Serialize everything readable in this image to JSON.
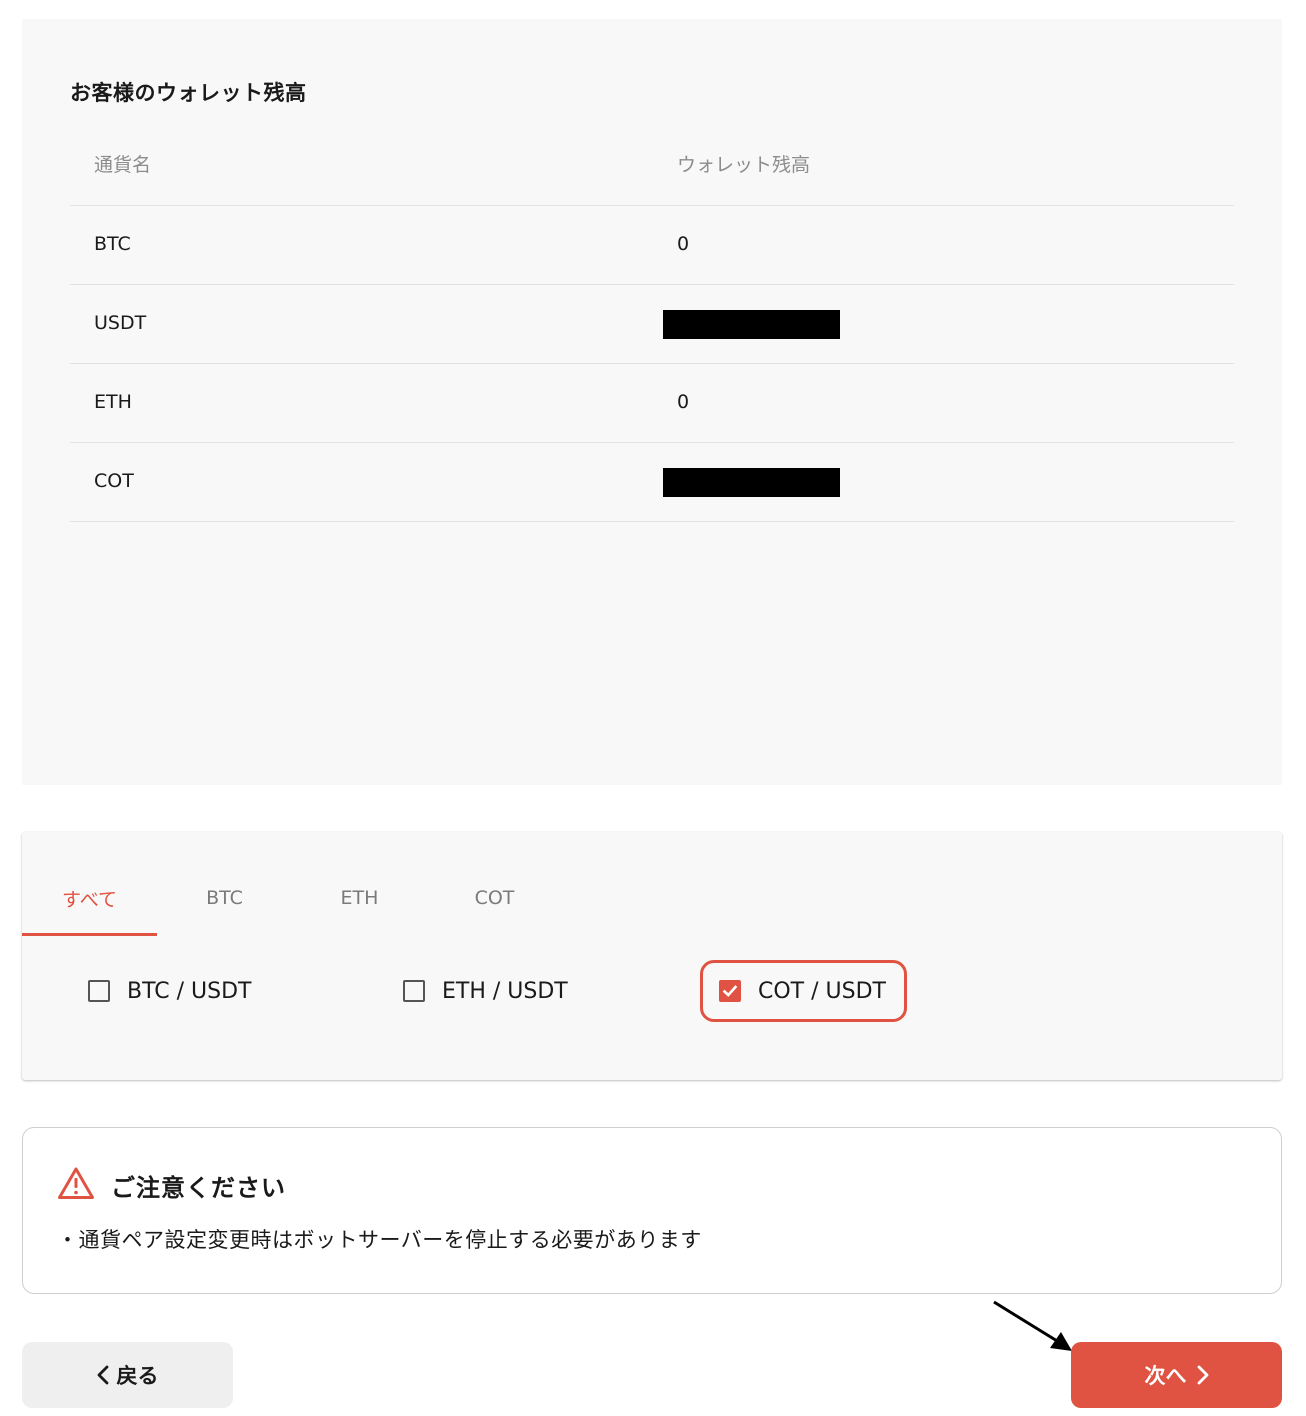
{
  "wallet": {
    "title": "お客様のウォレット残高",
    "headers": {
      "currency": "通貨名",
      "balance": "ウォレット残高"
    },
    "rows": [
      {
        "currency": "BTC",
        "balance": "0"
      },
      {
        "currency": "USDT",
        "balance": ""
      },
      {
        "currency": "ETH",
        "balance": "0"
      },
      {
        "currency": "COT",
        "balance": ""
      }
    ]
  },
  "pair_selector": {
    "tabs": [
      {
        "label": "すべて",
        "active": true
      },
      {
        "label": "BTC",
        "active": false
      },
      {
        "label": "ETH",
        "active": false
      },
      {
        "label": "COT",
        "active": false
      }
    ],
    "options": [
      {
        "label": "BTC / USDT",
        "checked": false
      },
      {
        "label": "ETH / USDT",
        "checked": false
      },
      {
        "label": "COT / USDT",
        "checked": true
      }
    ]
  },
  "notice": {
    "icon": "warning-icon",
    "title": "ご注意ください",
    "body": "・通貨ペア設定変更時はボットサーバーを停止する必要があります"
  },
  "actions": {
    "back_label": "戻る",
    "next_label": "次へ"
  },
  "colors": {
    "accent": "#e05342",
    "panel_bg": "#f8f8f8",
    "muted_text": "#8c8c8c"
  }
}
